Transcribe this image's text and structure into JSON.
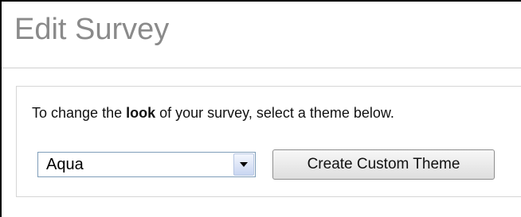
{
  "page": {
    "title": "Edit Survey"
  },
  "panel": {
    "instruction_prefix": "To change the ",
    "instruction_bold": "look",
    "instruction_suffix": " of your survey, select a theme below."
  },
  "theme_select": {
    "selected_value": "Aqua",
    "icon": "chevron-down-icon"
  },
  "actions": {
    "create_custom_theme_label": "Create Custom Theme"
  }
}
